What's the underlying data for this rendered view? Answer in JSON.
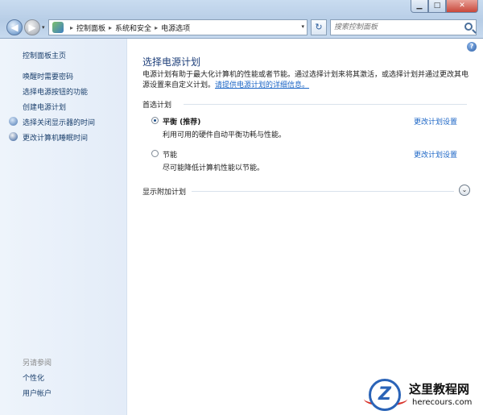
{
  "window": {
    "minimize": "▁",
    "maximize": "□",
    "close": "✕"
  },
  "nav": {
    "back": "◀",
    "forward": "▶",
    "dropdown": "▾",
    "refresh": "↻"
  },
  "breadcrumb": [
    "控制面板",
    "系统和安全",
    "电源选项"
  ],
  "breadcrumb_sep": "▸",
  "search": {
    "placeholder": "搜索控制面板"
  },
  "sidebar": {
    "home": "控制面板主页",
    "items": [
      "唤醒时需要密码",
      "选择电源按钮的功能",
      "创建电源计划",
      "选择关闭显示器的时间",
      "更改计算机睡眠时间"
    ],
    "see_also_label": "另请参阅",
    "see_also": [
      "个性化",
      "用户帐户"
    ]
  },
  "main": {
    "help": "?",
    "title": "选择电源计划",
    "description": "电源计划有助于最大化计算机的性能或者节能。通过选择计划来将其激活，或选择计划并通过更改其电源设置来自定义计划。",
    "more_info_link": "请提供电源计划的详细信息。",
    "preferred_label": "首选计划",
    "plans": [
      {
        "name": "平衡 (推荐)",
        "desc": "利用可用的硬件自动平衡功耗与性能。",
        "link": "更改计划设置",
        "selected": true
      },
      {
        "name": "节能",
        "desc": "尽可能降低计算机性能以节能。",
        "link": "更改计划设置",
        "selected": false
      }
    ],
    "show_more": "显示附加计划",
    "expand_icon": "⌄"
  },
  "logo": {
    "title": "这里教程网",
    "subtitle": "herecours.com",
    "mark": "Z"
  }
}
